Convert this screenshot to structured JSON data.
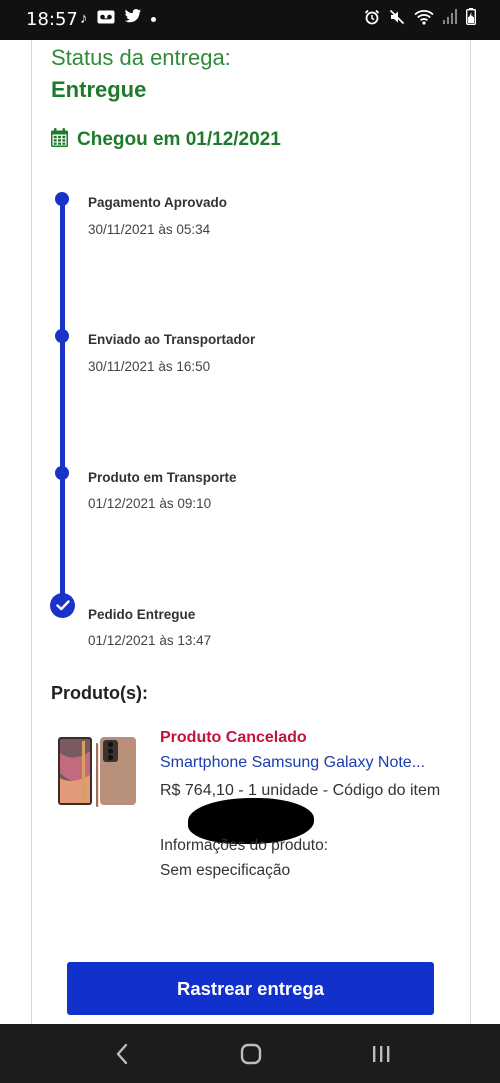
{
  "status_bar": {
    "time": "18:57",
    "left_icons": [
      "tiktok-icon",
      "voicemail-icon",
      "twitter-icon",
      "dot-icon"
    ],
    "right_icons": [
      "alarm-icon",
      "mute-icon",
      "wifi-icon",
      "signal-icon",
      "battery-charging-icon"
    ]
  },
  "delivery": {
    "status_label": "Status da entrega:",
    "status_value": "Entregue",
    "arrival_icon": "calendar-icon",
    "arrival_text": "Chegou em 01/12/2021"
  },
  "timeline": [
    {
      "title": "Pagamento Aprovado",
      "date": "30/11/2021 às 05:34"
    },
    {
      "title": "Enviado ao Transportador",
      "date": "30/11/2021 às 16:50"
    },
    {
      "title": "Produto em Transporte",
      "date": "01/12/2021 às 09:10"
    },
    {
      "title": "Pedido Entregue",
      "date": "01/12/2021 às 13:47"
    }
  ],
  "products": {
    "heading": "Produto(s):",
    "items": [
      {
        "status": "Produto Cancelado",
        "name": "Smartphone Samsung Galaxy Note...",
        "description": "R$ 764,10 - 1 unidade - Código do item",
        "info_label": "Informações do produto:",
        "info_value": "Sem especificação"
      }
    ]
  },
  "actions": {
    "track_label": "Rastrear entrega"
  },
  "colors": {
    "green": "#1e7a2c",
    "blue": "#1a33c7",
    "button": "#1230cc",
    "cancelled": "#c4123f",
    "link": "#1a3db0"
  },
  "nav_bar": {
    "icons": [
      "back-icon",
      "home-icon",
      "recents-icon"
    ]
  }
}
